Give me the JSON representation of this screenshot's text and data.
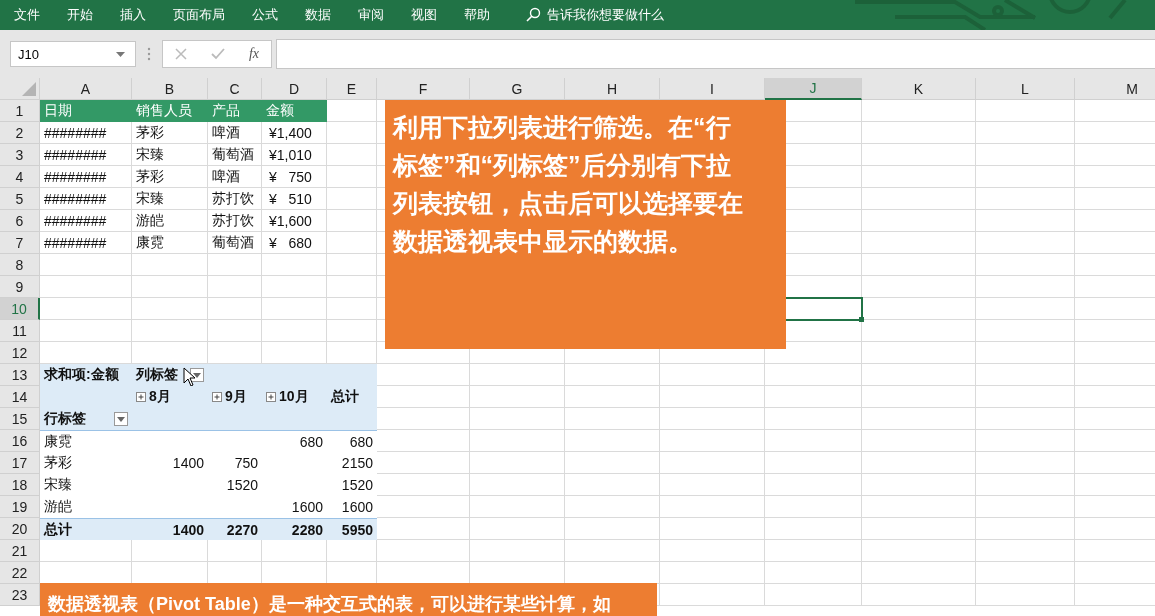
{
  "ribbon": {
    "tabs": [
      {
        "label": "文件"
      },
      {
        "label": "开始"
      },
      {
        "label": "插入"
      },
      {
        "label": "页面布局"
      },
      {
        "label": "公式"
      },
      {
        "label": "数据"
      },
      {
        "label": "审阅"
      },
      {
        "label": "视图"
      },
      {
        "label": "帮助"
      }
    ],
    "search": "告诉我你想要做什么"
  },
  "formula_bar": {
    "name_box": "J10",
    "function_button": "fx"
  },
  "columns": [
    {
      "label": "A",
      "selected": false
    },
    {
      "label": "B",
      "selected": false
    },
    {
      "label": "C",
      "selected": false
    },
    {
      "label": "D",
      "selected": false
    },
    {
      "label": "E",
      "selected": false
    },
    {
      "label": "F",
      "selected": false
    },
    {
      "label": "G",
      "selected": false
    },
    {
      "label": "H",
      "selected": false
    },
    {
      "label": "I",
      "selected": false
    },
    {
      "label": "J",
      "selected": true
    },
    {
      "label": "K",
      "selected": false
    },
    {
      "label": "L",
      "selected": false
    },
    {
      "label": "M",
      "selected": false
    }
  ],
  "rows": [
    {
      "label": "1",
      "selected": false
    },
    {
      "label": "2",
      "selected": false
    },
    {
      "label": "3",
      "selected": false
    },
    {
      "label": "4",
      "selected": false
    },
    {
      "label": "5",
      "selected": false
    },
    {
      "label": "6",
      "selected": false
    },
    {
      "label": "7",
      "selected": false
    },
    {
      "label": "8",
      "selected": false
    },
    {
      "label": "9",
      "selected": false
    },
    {
      "label": "10",
      "selected": true
    },
    {
      "label": "11",
      "selected": false
    },
    {
      "label": "12",
      "selected": false
    },
    {
      "label": "13",
      "selected": false
    },
    {
      "label": "14",
      "selected": false
    },
    {
      "label": "15",
      "selected": false
    },
    {
      "label": "16",
      "selected": false
    },
    {
      "label": "17",
      "selected": false
    },
    {
      "label": "18",
      "selected": false
    },
    {
      "label": "19",
      "selected": false
    },
    {
      "label": "20",
      "selected": false
    },
    {
      "label": "21",
      "selected": false
    },
    {
      "label": "22",
      "selected": false
    },
    {
      "label": "23",
      "selected": false
    }
  ],
  "source_table": {
    "headers": [
      "日期",
      "销售人员",
      "产品",
      "金额"
    ],
    "rows": [
      [
        "########",
        "茅彩",
        "啤酒",
        "¥1,400"
      ],
      [
        "########",
        "宋臻",
        "葡萄酒",
        "¥1,010"
      ],
      [
        "########",
        "茅彩",
        "啤酒",
        "¥   750"
      ],
      [
        "########",
        "宋臻",
        "苏打饮",
        "¥   510"
      ],
      [
        "########",
        "游皑",
        "苏打饮",
        "¥1,600"
      ],
      [
        "########",
        "康霓",
        "葡萄酒",
        "¥   680"
      ]
    ]
  },
  "pivot": {
    "corner": "求和项:金额",
    "column_label": "列标签",
    "row_label": "行标签",
    "months": [
      "8月",
      "9月",
      "10月"
    ],
    "total_label": "总计",
    "rows": [
      {
        "name": "康霓",
        "month_3": "680",
        "total": "680"
      },
      {
        "name": "茅彩",
        "month_1": "1400",
        "month_2": "750",
        "total": "2150"
      },
      {
        "name": "宋臻",
        "month_2": "1520",
        "total": "1520"
      },
      {
        "name": "游皑",
        "month_3": "1600",
        "total": "1600"
      }
    ],
    "total_row": {
      "name": "总计",
      "month_1": "1400",
      "month_2": "2270",
      "month_3": "2280",
      "total": "5950"
    }
  },
  "callouts": [
    "利用下拉列表进行筛选。在“行标签”和“列标签”后分别有下拉列表按钮，点击后可以选择要在数据透视表中显示的数据。",
    "数据透视表（Pivot Table）是一种交互式的表，可以进行某些计算，如"
  ]
}
